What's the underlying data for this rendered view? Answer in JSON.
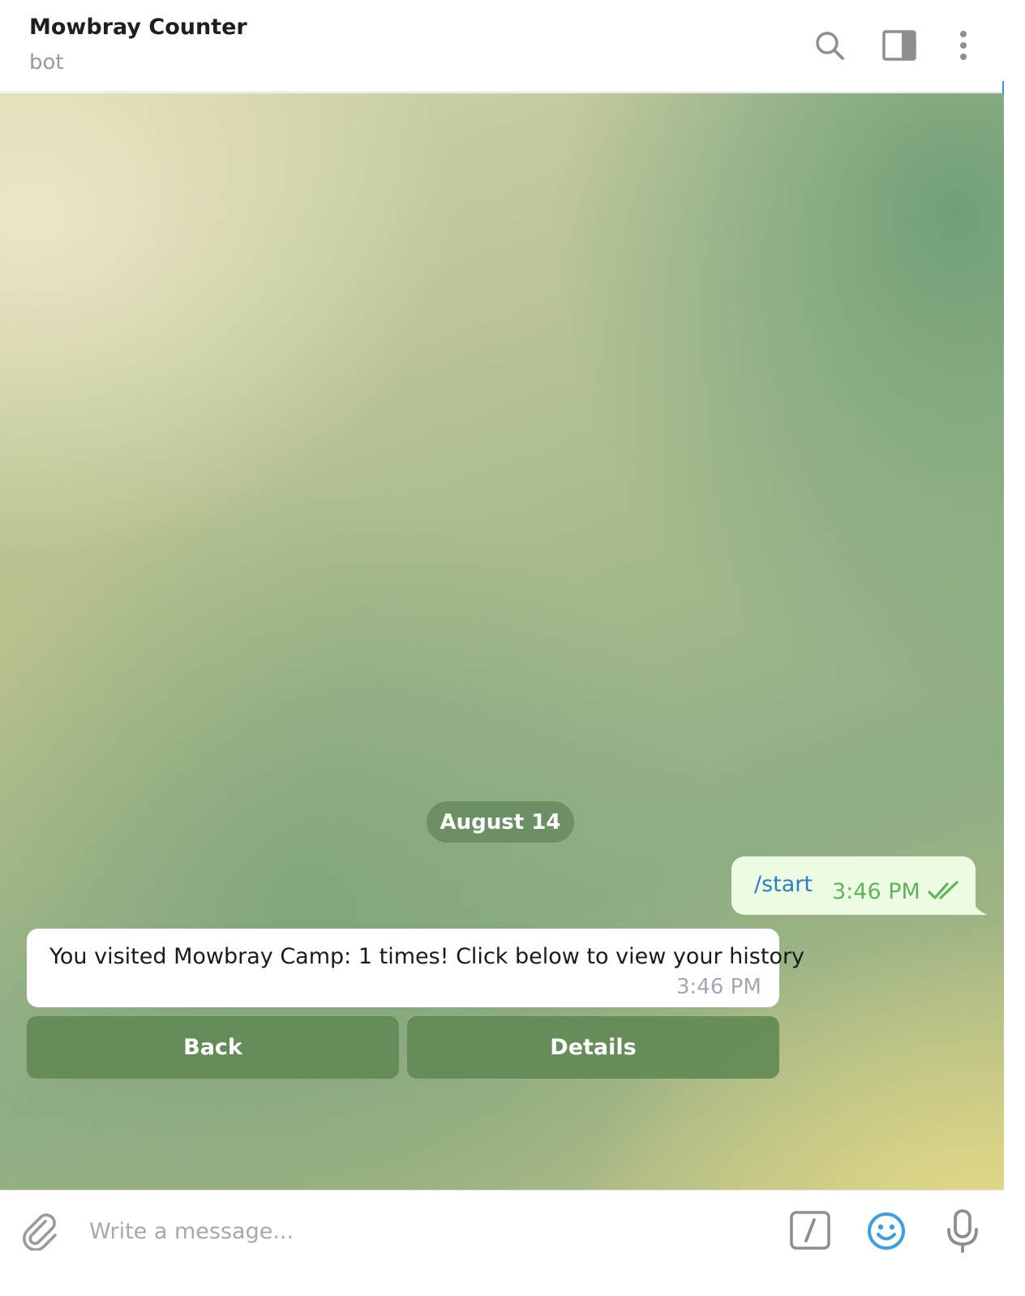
{
  "header": {
    "title": "Mowbray Counter",
    "subtitle": "bot",
    "icons": [
      "search-icon",
      "side-panel-icon",
      "more-vertical-icon"
    ]
  },
  "conversation": {
    "date_separator": "August 14",
    "outgoing": {
      "text": "/start",
      "time": "3:46 PM",
      "status": "read"
    },
    "incoming": {
      "text": "You visited Mowbray Camp: 1 times! Click below to view your history",
      "time": "3:46 PM"
    },
    "inline_keyboard": [
      {
        "label": "Back"
      },
      {
        "label": "Details"
      }
    ]
  },
  "composer": {
    "placeholder": "Write a message...",
    "icons": [
      "paperclip-icon",
      "bot-command-icon",
      "emoji-icon",
      "microphone-icon"
    ]
  },
  "colors": {
    "link_blue": "#2a7fc6",
    "outgoing_bubble": "#eefbe3",
    "outgoing_time": "#5fb45a",
    "keyboard_button": "#608854",
    "emoji_accent": "#3aa0e0"
  }
}
